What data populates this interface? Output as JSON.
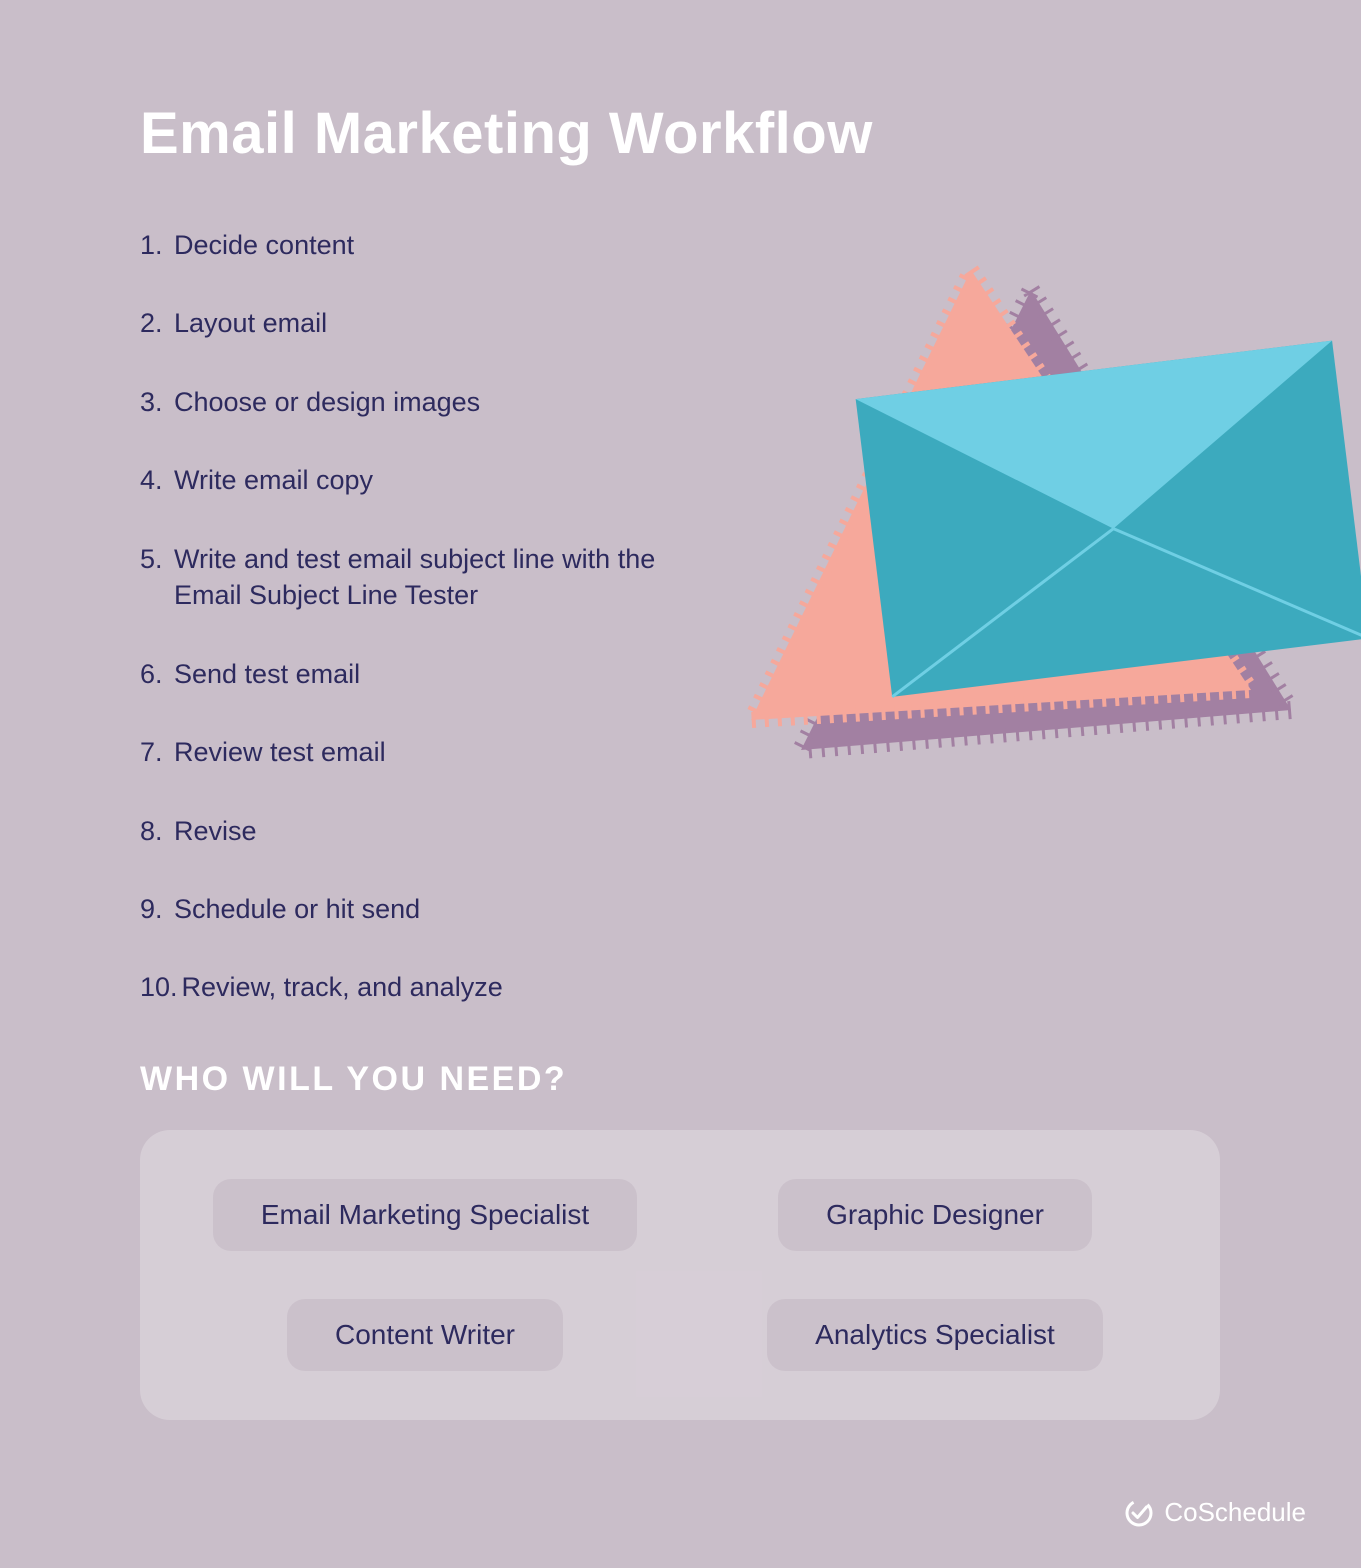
{
  "title": "Email Marketing Workflow",
  "steps": [
    "Decide content",
    "Layout email",
    "Choose or design images",
    "Write email copy",
    "Write and test email subject line with the Email Subject Line Tester",
    "Send test email",
    "Review test email",
    "Revise",
    "Schedule or hit send",
    "Review, track, and analyze"
  ],
  "who_heading": "WHO WILL YOU NEED?",
  "roles": [
    "Email Marketing Specialist",
    "Graphic Designer",
    "Content Writer",
    "Analytics Specialist"
  ],
  "brand": "CoSchedule",
  "colors": {
    "background": "#c9bec9",
    "text_primary": "#2d2a5e",
    "text_light": "#ffffff",
    "envelope_light": "#6fcfe4",
    "envelope_dark": "#3caabe",
    "triangle_pink": "#f6a89b",
    "triangle_purple": "#9e7a9e"
  }
}
